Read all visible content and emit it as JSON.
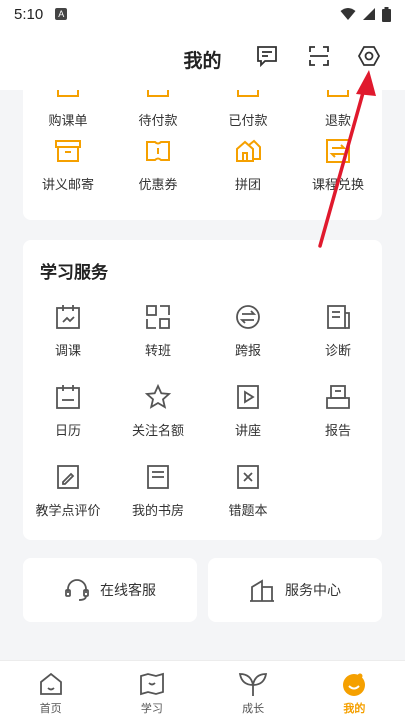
{
  "status": {
    "time": "5:10",
    "notif": "A"
  },
  "header": {
    "title": "我的",
    "icons": [
      "message-icon",
      "scan-icon",
      "settings-icon"
    ]
  },
  "top_grid": {
    "row1": [
      "购课单",
      "待付款",
      "已付款",
      "退款"
    ],
    "row2": [
      "讲义邮寄",
      "优惠券",
      "拼团",
      "课程兑换"
    ]
  },
  "study": {
    "title": "学习服务",
    "items": [
      "调课",
      "转班",
      "跨报",
      "诊断",
      "日历",
      "关注名额",
      "讲座",
      "报告",
      "教学点评价",
      "我的书房",
      "错题本"
    ]
  },
  "services": {
    "online": "在线客服",
    "center": "服务中心"
  },
  "tabbar": {
    "tabs": [
      "首页",
      "学习",
      "成长",
      "我的"
    ],
    "active": 3
  },
  "colors": {
    "accent": "#f5a000",
    "annotation": "#e0192d"
  }
}
